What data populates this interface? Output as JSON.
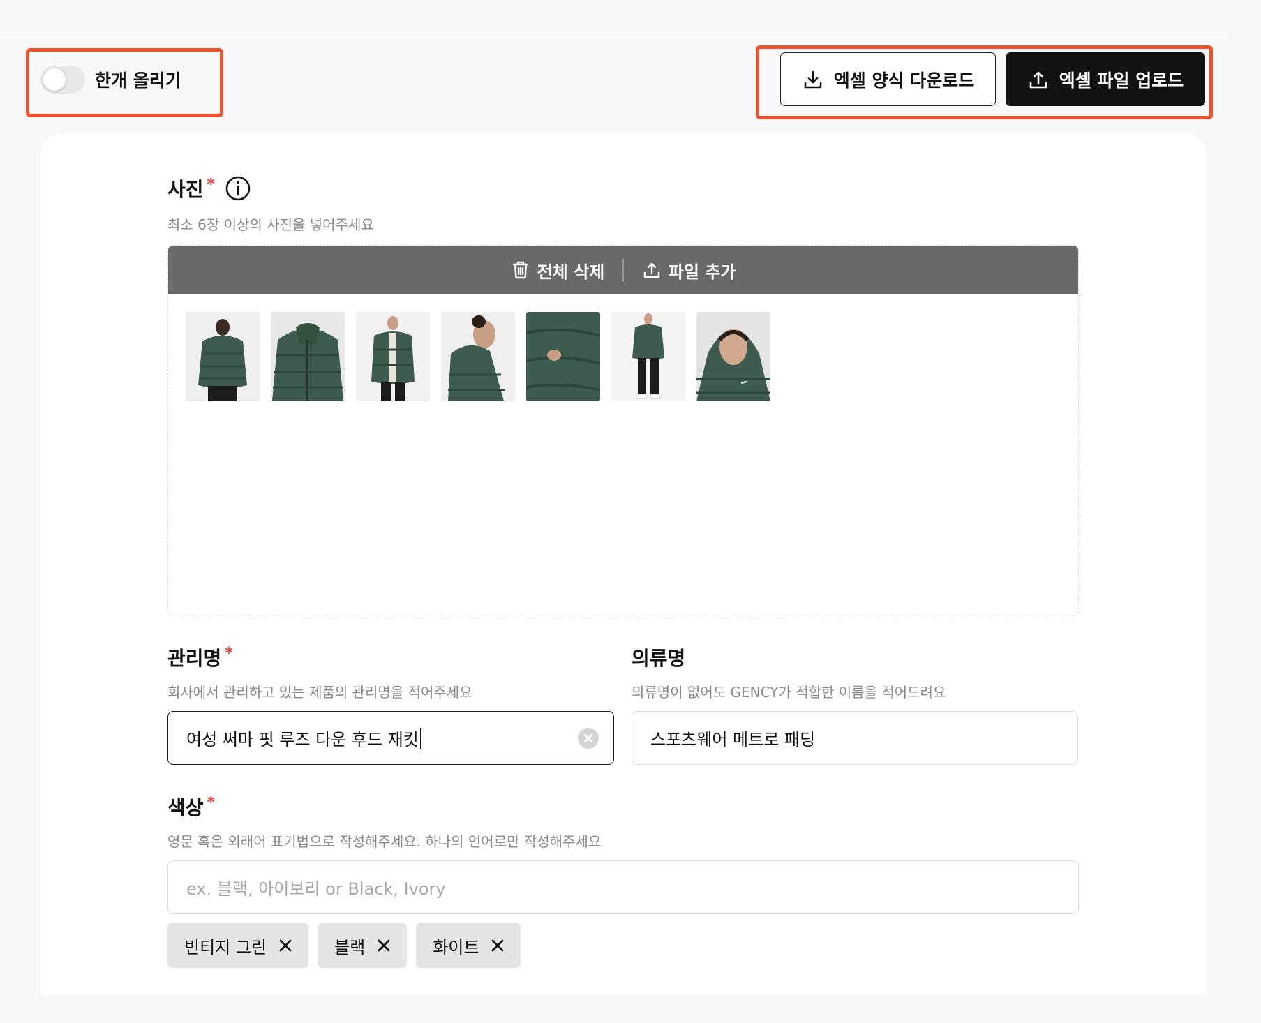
{
  "top_bar": {
    "toggle_label": "한개 올리기",
    "toggle_on": false,
    "download_template_label": "엑셀 양식 다운로드",
    "upload_file_label": "엑셀 파일 업로드"
  },
  "photos": {
    "title": "사진",
    "required_mark": "*",
    "hint": "최소 6장 이상의 사진을 넣어주세요",
    "delete_all_label": "전체 삭제",
    "add_file_label": "파일 추가",
    "thumbnails": [
      {
        "name": "photo-back-view"
      },
      {
        "name": "photo-front-jacket"
      },
      {
        "name": "photo-full-front"
      },
      {
        "name": "photo-side-hood"
      },
      {
        "name": "photo-sleeve-detail"
      },
      {
        "name": "photo-full-body"
      },
      {
        "name": "photo-face-closeup"
      }
    ],
    "jacket_color": "#3d5b4e"
  },
  "management_name": {
    "title": "관리명",
    "required_mark": "*",
    "hint": "회사에서 관리하고 있는 제품의 관리명을 적어주세요",
    "value": "여성 써마 핏 루즈 다운 후드 재킷"
  },
  "clothing_name": {
    "title": "의류명",
    "hint": "의류명이 없어도 GENCY가 적합한 이름을 적어드려요",
    "value": "스포츠웨어 메트로 패딩"
  },
  "color": {
    "title": "색상",
    "required_mark": "*",
    "hint": "영문 혹은 외래어 표기법으로 작성해주세요. 하나의 언어로만 작성해주세요",
    "placeholder": "ex. 블랙, 아이보리 or Black, Ivory",
    "chips": [
      "빈티지 그린",
      "블랙",
      "화이트"
    ]
  },
  "colors": {
    "highlight": "#f0522d",
    "required": "#e8403a",
    "photo_bar": "#696969",
    "dark_button": "#121212"
  }
}
